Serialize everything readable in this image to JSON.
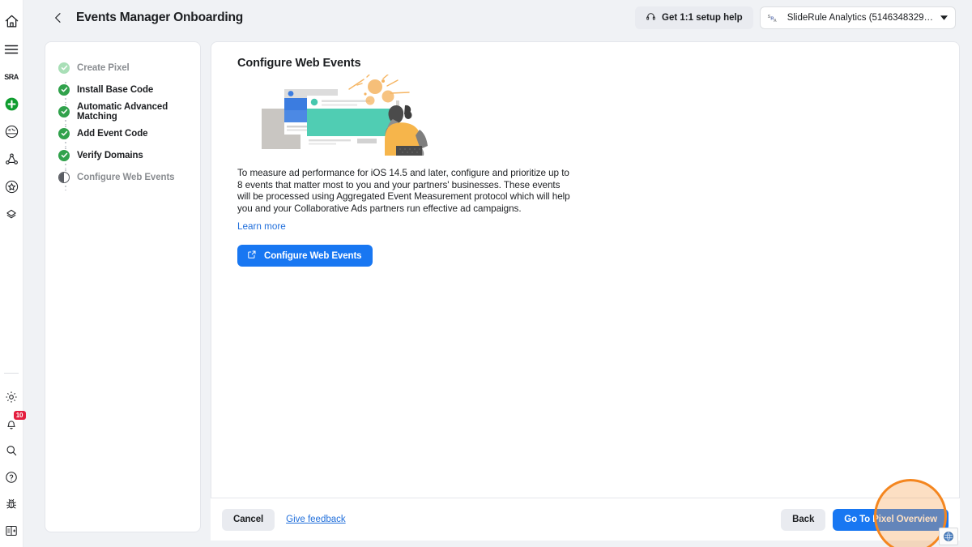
{
  "rail": {
    "top_items": [
      {
        "name": "home-icon",
        "label": "Home"
      },
      {
        "name": "menu-icon",
        "label": "All tools"
      },
      {
        "name": "account-badge-icon",
        "label": "Account"
      },
      {
        "name": "create-icon",
        "label": "Create"
      },
      {
        "name": "ads-manager-icon",
        "label": "Ads Manager"
      },
      {
        "name": "audiences-icon",
        "label": "Audiences"
      },
      {
        "name": "brand-safety-icon",
        "label": "Brand Safety"
      },
      {
        "name": "events-manager-icon",
        "label": "Events Manager"
      }
    ],
    "bottom_items": [
      {
        "name": "settings-gear-icon",
        "label": "Settings"
      },
      {
        "name": "notifications-bell-icon",
        "label": "Notifications",
        "badge": "10"
      },
      {
        "name": "search-icon",
        "label": "Search"
      },
      {
        "name": "help-circle-icon",
        "label": "Help"
      },
      {
        "name": "bug-report-icon",
        "label": "Report a bug"
      },
      {
        "name": "collapse-panel-icon",
        "label": "Collapse panel"
      }
    ],
    "account_initials": "SRA"
  },
  "header": {
    "back_label": "Back",
    "title": "Events Manager Onboarding",
    "help_pill_label": "Get 1:1 setup help",
    "account_selector": {
      "initials": "SRA",
      "name": "SlideRule Analytics (5146348329…",
      "caret": "▼"
    }
  },
  "steps": [
    {
      "label": "Create Pixel",
      "state": "complete-faded"
    },
    {
      "label": "Install Base Code",
      "state": "complete"
    },
    {
      "label": "Automatic Advanced Matching",
      "state": "complete"
    },
    {
      "label": "Add Event Code",
      "state": "complete"
    },
    {
      "label": "Verify Domains",
      "state": "complete"
    },
    {
      "label": "Configure Web Events",
      "state": "in-progress"
    }
  ],
  "main": {
    "title": "Configure Web Events",
    "illustration_name": "person-at-desktop-illustration",
    "body": "To measure ad performance for iOS 14.5 and later, configure and prioritize up to 8 events that matter most to you and your partners' businesses. These events will be processed using Aggregated Event Measurement protocol which will help you and your Collaborative Ads partners run effective ad campaigns.",
    "learn_more_label": "Learn more",
    "cta_label": "Configure Web Events"
  },
  "footer": {
    "cancel_label": "Cancel",
    "feedback_label": "Give feedback",
    "back_label": "Back",
    "primary_label": "Go To Pixel Overview"
  },
  "annotation": {
    "name": "highlight-circle",
    "target": "Go To Pixel Overview",
    "stroke_color": "#f4861f",
    "fill_color": "rgba(246,162,80,0.34)"
  },
  "taskbar": {
    "tray_icon_name": "globe-icon"
  },
  "colors": {
    "accent_blue": "#1877f2",
    "link_blue": "#216fdb",
    "success_green": "#31a24c",
    "success_green_faded": "#a9dfb7",
    "page_bg": "#f0f2f5",
    "card_border": "#e4e6eb",
    "badge_red": "#e41e3f"
  }
}
